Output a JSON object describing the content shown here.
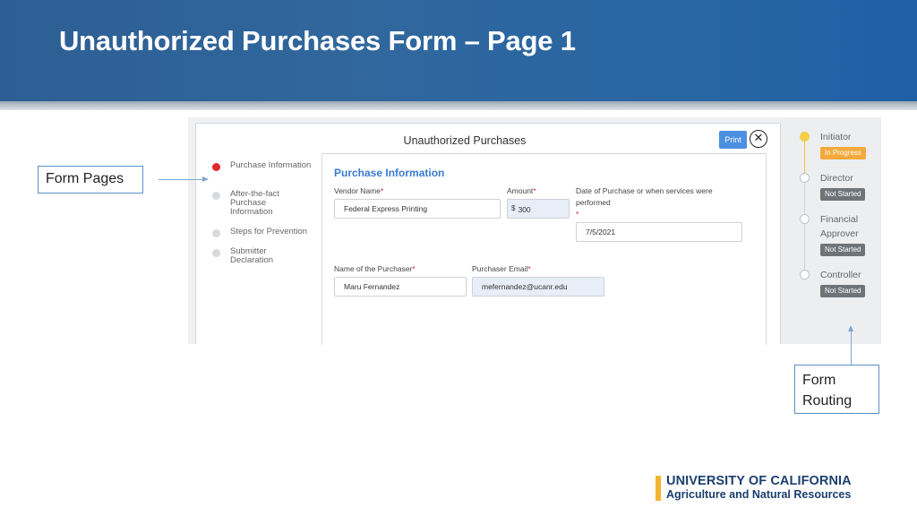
{
  "slide": {
    "title": "Unauthorized Purchases Form – Page 1"
  },
  "form": {
    "title": "Unauthorized Purchases",
    "print_label": "Print",
    "close_symbol": "⊗",
    "steps": [
      {
        "label": "Purchase Information",
        "active": true
      },
      {
        "label": "After-the-fact Purchase Information",
        "active": false
      },
      {
        "label": "Steps for Prevention",
        "active": false
      },
      {
        "label": "Submitter Declaration",
        "active": false
      }
    ],
    "section_title": "Purchase Information",
    "fields": {
      "vendor_label": "Vendor Name",
      "vendor_value": "Federal Express Printing",
      "amount_label": "Amount",
      "amount_currency": "$",
      "amount_value": "300",
      "date_label": "Date of Purchase or when services were performed",
      "date_value": "7/5/2021",
      "purchaser_label": "Name of the Purchaser",
      "purchaser_value": "Maru Fernandez",
      "email_label": "Purchaser Email",
      "email_value": "mefernandez@ucanr.edu",
      "required_mark": "*"
    }
  },
  "routing": [
    {
      "name": "Initiator",
      "status": "In Progress"
    },
    {
      "name": "Director",
      "status": "Not Started"
    },
    {
      "name": "Financial Approver",
      "status": "Not Started"
    },
    {
      "name": "Controller",
      "status": "Not Started"
    }
  ],
  "callouts": {
    "form_pages": "Form Pages",
    "form_routing": "Form Routing"
  },
  "logo": {
    "line1": "UNIVERSITY OF CALIFORNIA",
    "line2": "Agriculture and Natural Resources"
  },
  "colors": {
    "header_blue": "#2d5f94",
    "accent_blue": "#3a7cd0",
    "active_red": "#e5262c",
    "in_progress": "#f4a93d",
    "not_started": "#6f7478",
    "logo_gold": "#f2b531",
    "logo_navy": "#1b3f6f"
  }
}
